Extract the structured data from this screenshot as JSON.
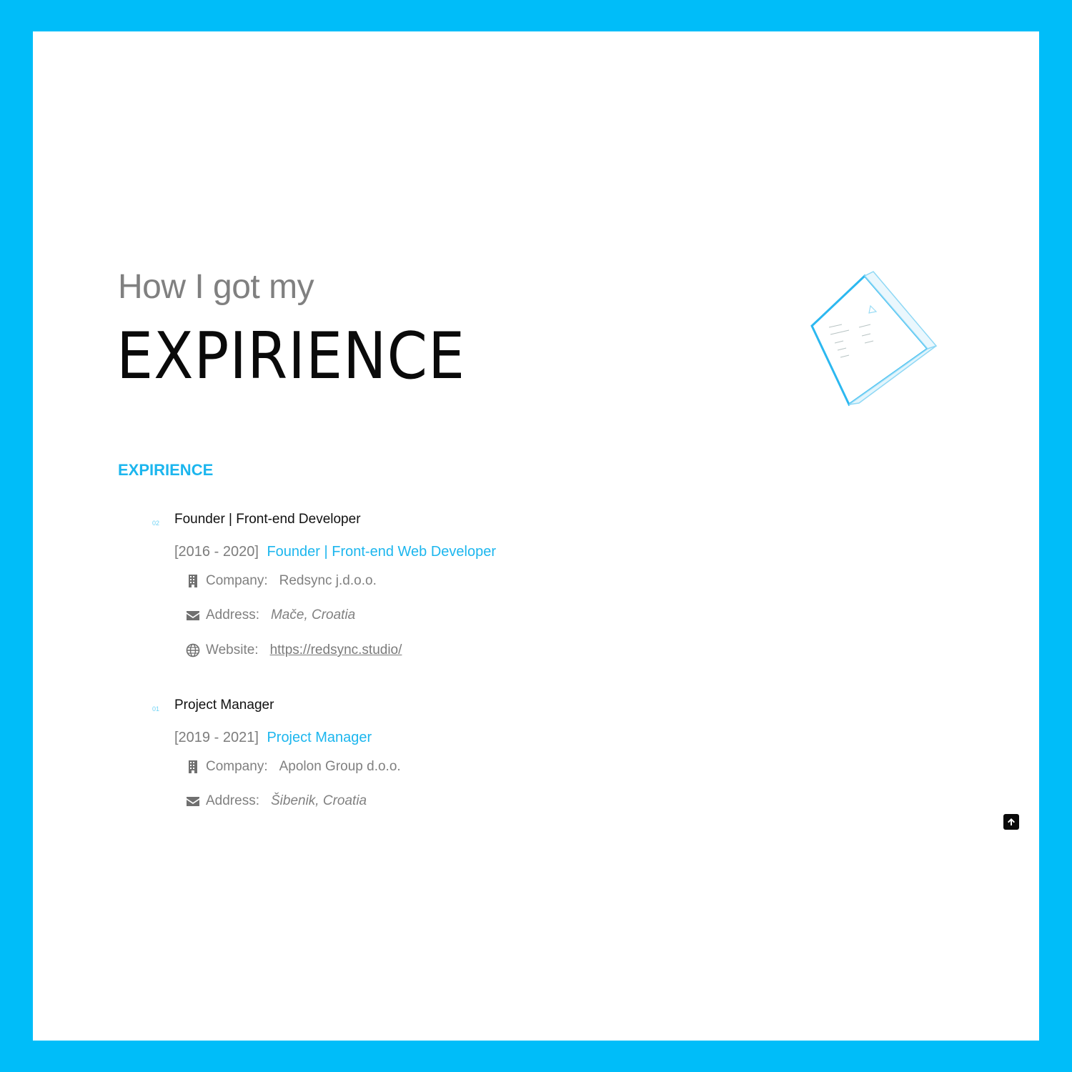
{
  "header": {
    "subtitle": "How I got my",
    "title": "EXPIRIENCE"
  },
  "section": {
    "label": "EXPIRIENCE"
  },
  "jobs": [
    {
      "number": "02",
      "title": "Founder | Front-end Developer",
      "period": "[2016 - 2020]",
      "role": "Founder | Front-end Web Developer",
      "company_label": "Company:",
      "company": "Redsync j.d.o.o.",
      "address_label": "Address:",
      "address": "Mače, Croatia",
      "website_label": "Website:",
      "website": "https://redsync.studio/"
    },
    {
      "number": "01",
      "title": "Project Manager",
      "period": "[2019 - 2021]",
      "role": "Project Manager",
      "company_label": "Company:",
      "company": "Apolon Group d.o.o.",
      "address_label": "Address:",
      "address": "Šibenik, Croatia"
    }
  ],
  "icons": {
    "company": "building-icon",
    "address": "envelope-icon",
    "website": "globe-icon",
    "scroll_top": "arrow-up-icon"
  },
  "colors": {
    "frame": "#00bdf9",
    "accent": "#1cb6ee",
    "heading": "#0a0a0a",
    "muted": "#808080"
  }
}
